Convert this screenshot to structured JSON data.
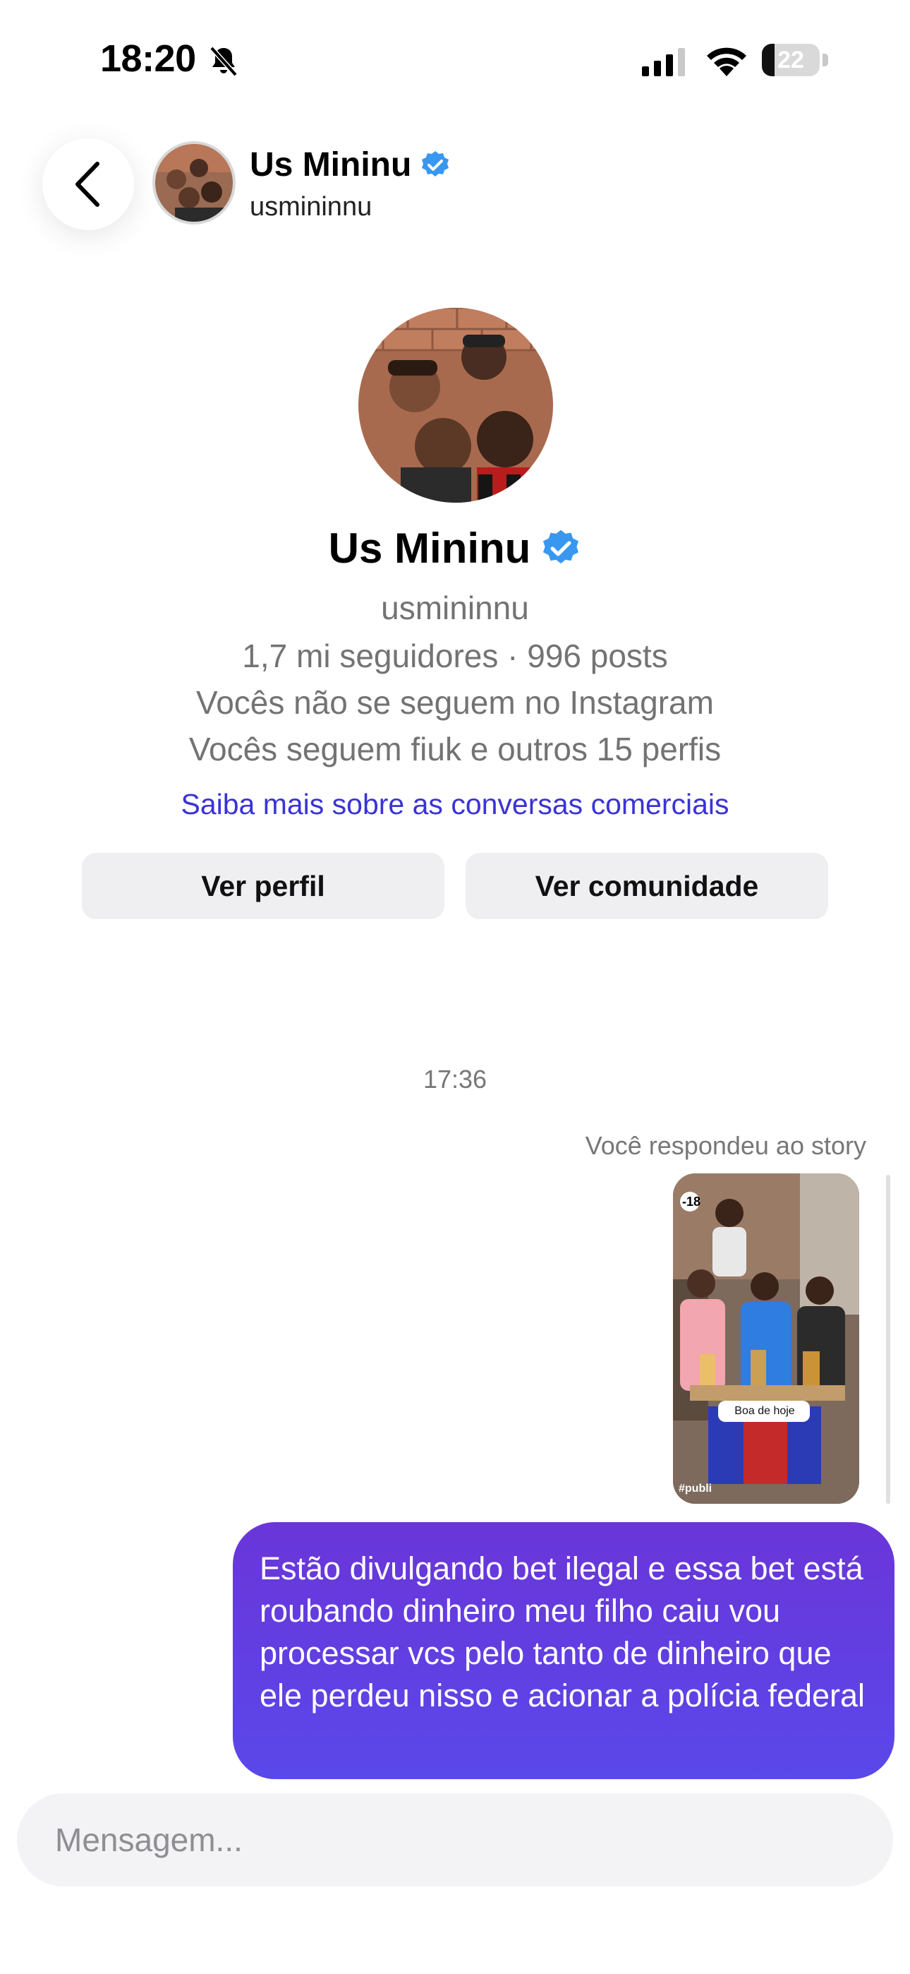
{
  "status_bar": {
    "time": "18:20",
    "battery": "22",
    "battery_level": 0.22
  },
  "header": {
    "name": "Us Mininu",
    "username": "usmininnu"
  },
  "profile": {
    "name": "Us Mininu",
    "username": "usmininnu",
    "stats": "1,7 mi seguidores · 996 posts",
    "follow_status": "Vocês não se seguem no Instagram",
    "mutual": "Vocês seguem fiuk e outros 15 perfis",
    "info_link": "Saiba mais sobre as conversas comerciais",
    "btn_profile": "Ver perfil",
    "btn_community": "Ver comunidade"
  },
  "chat": {
    "timestamp": "17:36",
    "story_reply_label": "Você respondeu ao story",
    "story": {
      "age_badge": "-18",
      "sticker": "Boa de hoje",
      "tag": "#publi"
    },
    "message": "Estão divulgando bet ilegal e essa bet está roubando dinheiro meu filho caiu vou processar vcs pelo tanto de dinheiro que ele perdeu nisso e acionar a polícia federal"
  },
  "composer": {
    "placeholder": "Mensagem..."
  },
  "colors": {
    "accent_link": "#3a33d6",
    "bubble": "#5a48ea",
    "verified": "#3897f0"
  }
}
